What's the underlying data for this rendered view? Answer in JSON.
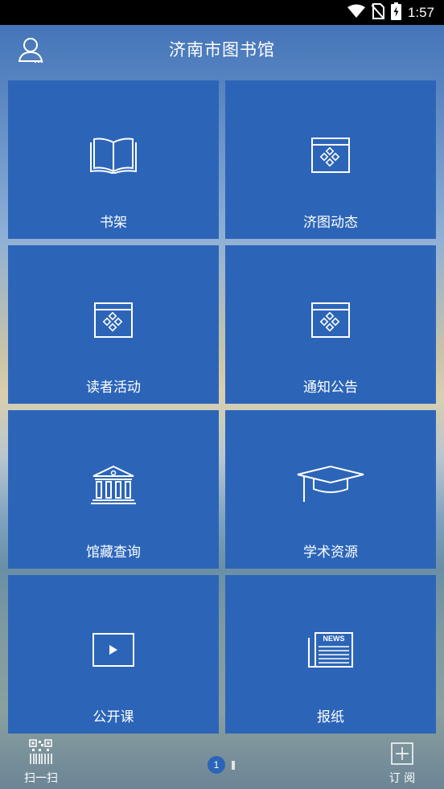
{
  "status_bar": {
    "time": "1:57",
    "icons": [
      "wifi-icon",
      "no-sim-icon",
      "battery-charging-icon"
    ]
  },
  "header": {
    "title": "济南市图书馆",
    "user_icon": "user-icon"
  },
  "tiles": [
    {
      "label": "书架",
      "icon": "book-icon"
    },
    {
      "label": "济图动态",
      "icon": "window-diamond-icon"
    },
    {
      "label": "读者活动",
      "icon": "window-diamond-icon"
    },
    {
      "label": "通知公告",
      "icon": "window-diamond-icon"
    },
    {
      "label": "馆藏查询",
      "icon": "library-building-icon"
    },
    {
      "label": "学术资源",
      "icon": "graduation-cap-icon"
    },
    {
      "label": "公开课",
      "icon": "play-video-icon"
    },
    {
      "label": "报纸",
      "icon": "newspaper-icon"
    }
  ],
  "newspaper_badge": "NEWS",
  "bottom_bar": {
    "scan_label": "扫一扫",
    "scan_icon": "qr-barcode-icon",
    "subscribe_label": "订 阅",
    "subscribe_icon": "plus-box-icon",
    "page_current": "1"
  },
  "colors": {
    "tile_bg": "#2c65b8",
    "statusbar": "#000000",
    "text": "#ffffff"
  }
}
